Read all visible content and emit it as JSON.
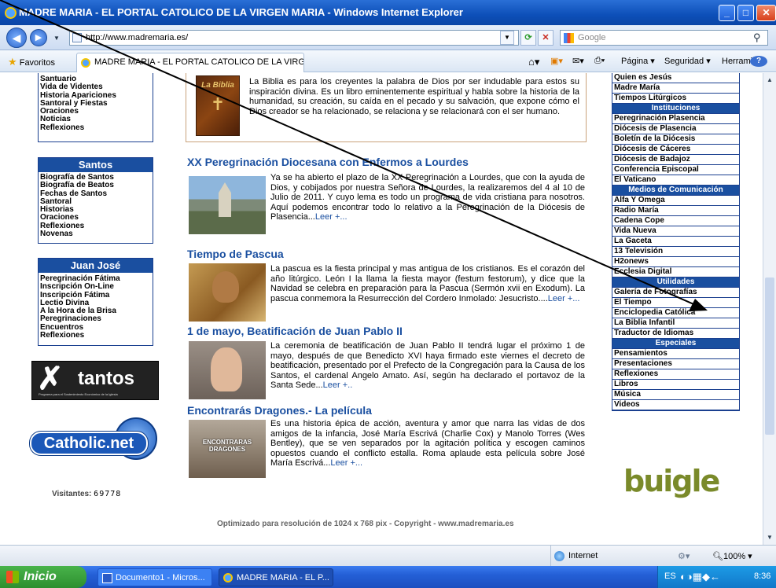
{
  "window": {
    "title": "MADRE MARIA - EL PORTAL CATOLICO DE LA VIRGEN MARIA - Windows Internet Explorer"
  },
  "address": {
    "url": "http://www.madremaria.es/",
    "search_placeholder": "Google"
  },
  "favorites": {
    "label": "Favoritos",
    "tab_label": "MADRE MARIA - EL PORTAL CATOLICO DE LA VIRGE..."
  },
  "commands": {
    "pagina": "Página ▾",
    "seguridad": "Seguridad ▾",
    "herramientas": "Herramientas ▾"
  },
  "left": {
    "box1_items": [
      "Santuario",
      "Vida de Videntes",
      "Historia Apariciones",
      "Santoral y Fiestas",
      "Oraciones",
      "Noticias",
      "Reflexiones"
    ],
    "santos": {
      "title": "Santos",
      "items": [
        "Biografía de Santos",
        "Biografía de Beatos",
        "Fechas de Santos",
        "Santoral",
        "Historias",
        "Oraciones",
        "Reflexiones",
        "Novenas"
      ]
    },
    "juanjose": {
      "title": "Juan José",
      "items": [
        "Peregrinación Fátima",
        "Inscripción On-Line",
        "Inscripción Fátima",
        "Lectio Divina",
        "A la Hora de la Brisa",
        "Peregrinaciones",
        "Encuentros",
        "Reflexiones"
      ]
    },
    "xtantos": {
      "logo_text": "tantos",
      "subtitle": "Programa para el Sostenimiento Económico de la Iglesia"
    },
    "catholic": {
      "logo_text": "Catholic.net"
    },
    "visitors_label": "Visitantes:",
    "visitors_count": "69778"
  },
  "bible": {
    "text": "La Biblia es para los creyentes la palabra de Dios por ser indudable para estos su inspiración divina. Es un libro eminentemente espiritual y habla sobre la historia de la humanidad, su creación, su caída en el pecado y su salvación, que expone cómo el Dios creador se ha relacionado, se relaciona y se relacionará con el ser humano.",
    "cover_text": "La Biblia"
  },
  "articles": [
    {
      "title": "XX Peregrinación Diocesana con Enfermos a Lourdes",
      "text": "Ya se ha abierto el plazo de la XX Peregrinación a Lourdes, que con la ayuda de Dios, y cobijados por nuestra Señora de Lourdes, la realizaremos del 4 al 10 de Julio de 2011. Y cuyo lema es todo un programa de vida cristiana para nosotros. Aquí podemos encontrar todo lo relativo a la Peregrinación de la Diócesis de Plasencia...",
      "more": "Leer +..."
    },
    {
      "title": "Tiempo de Pascua",
      "text": "La pascua es la fiesta principal y mas antigua de los cristianos. Es el corazón del año litúrgico. León I la llama la fiesta mayor (festum festorum), y dice que la Navidad se celebra en preparación para la Pascua (Sermón xvii en Exodum). La pascua conmemora la Resurrección del Cordero Inmolado: Jesucristo....",
      "more": "Leer +..."
    },
    {
      "title": "1 de mayo, Beatificación de Juan Pablo II",
      "text": "La ceremonia de beatificación de Juan Pablo II tendrá lugar el próximo 1 de mayo, después de que Benedicto XVI haya firmado este viernes el decreto de beatificación, presentado por el Prefecto de la Congregación para la Causa de los Santos, el cardenal Angelo Amato. Así, según ha declarado el portavoz de la Santa Sede...",
      "more": "Leer +.."
    },
    {
      "title": "Encontrarás Dragones.- La película",
      "text": "Es una historia épica de acción, aventura y amor que narra las vidas de dos amigos de la infancia, José María Escrivá (Charlie Cox) y Manolo Torres (Wes Bentley), que se ven separados por la agitación política y escogen caminos opuestos cuando el conflicto estalla. Roma aplaude esta película sobre José María Escrivá...",
      "more": "Leer +...",
      "thumb_text": "ENCONTRARAS DRAGONES"
    }
  ],
  "right": {
    "items": [
      {
        "t": "Quien es Jesús"
      },
      {
        "t": "Madre María"
      },
      {
        "t": "Tiempos Litúrgicos"
      },
      {
        "h": "Instituciones"
      },
      {
        "t": "Peregrinación Plasencia"
      },
      {
        "t": "Diócesis de Plasencia"
      },
      {
        "t": "Boletín de la Diócesis"
      },
      {
        "t": "Diócesis de Cáceres"
      },
      {
        "t": "Diócesis de Badajoz"
      },
      {
        "t": "Conferencia Episcopal"
      },
      {
        "t": "El Vaticano"
      },
      {
        "h": "Medios de Comunicación"
      },
      {
        "t": "Alfa Y Omega"
      },
      {
        "t": "Radio María"
      },
      {
        "t": "Cadena Cope"
      },
      {
        "t": "Vida Nueva"
      },
      {
        "t": "La Gaceta"
      },
      {
        "t": "13 Televisión"
      },
      {
        "t": "H2onews"
      },
      {
        "t": "Ecclesia Digital"
      },
      {
        "h": "Utilidades"
      },
      {
        "t": "Galería de Fotografías"
      },
      {
        "t": "El Tiempo"
      },
      {
        "t": "Enciclopedia Católica"
      },
      {
        "t": "La Biblia Infantil"
      },
      {
        "t": "Traductor de Idiomas"
      },
      {
        "h": "Especiales"
      },
      {
        "t": "Pensamientos"
      },
      {
        "t": "Presentaciones"
      },
      {
        "t": "Reflexiones"
      },
      {
        "t": "Libros"
      },
      {
        "t": "Música"
      },
      {
        "t": "Videos"
      }
    ],
    "buigle": "buigle"
  },
  "footer": "Optimizado para resolución de 1024 x 768 pix - Copyright - www.madremaria.es",
  "status": {
    "zone": "Internet",
    "zoom": "100%"
  },
  "taskbar": {
    "start": "Inicio",
    "task1": "Documento1 - Micros...",
    "task2": "MADRE MARIA - EL P...",
    "lang": "ES",
    "time": "8:36"
  },
  "colors": {
    "accent": "#1a4fa0",
    "title_blue": "#0d4fb8"
  }
}
